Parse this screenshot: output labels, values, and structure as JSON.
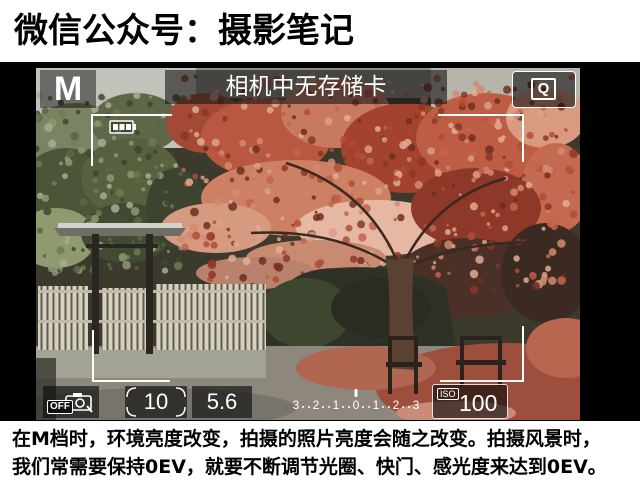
{
  "header": {
    "title": "微信公众号：摄影笔记"
  },
  "camera": {
    "mode": "M",
    "message": "相机中无存储卡",
    "quick_control": {
      "label": "Q"
    },
    "battery": {
      "level": 1
    },
    "touch_shutter": {
      "label": "OFF"
    },
    "shutter_speed": "10",
    "aperture": "5.6",
    "exposure": {
      "labels": [
        "3",
        "2",
        "1",
        "0",
        "1",
        "2",
        "3"
      ],
      "level": 0
    },
    "iso": {
      "label": "ISO",
      "value": "100"
    }
  },
  "caption": {
    "lines": [
      "在M档时，环境亮度改变，拍摄的照片亮度会随之改变。拍摄风景时，",
      "我们常需要保持0EV，就要不断调节光圈、快门、感光度来达到0EV。"
    ]
  },
  "icons": {
    "quick_control": "q-icon",
    "battery": "battery-icon",
    "touch_shutter": "touch-shutter-off-icon",
    "dial": "dial-arcs-icon"
  },
  "colors": {
    "page_background": "#ffffff",
    "screen_frame": "#000000",
    "overlay_text": "#ffffff",
    "overlay_panel": "#1a1a1a"
  }
}
